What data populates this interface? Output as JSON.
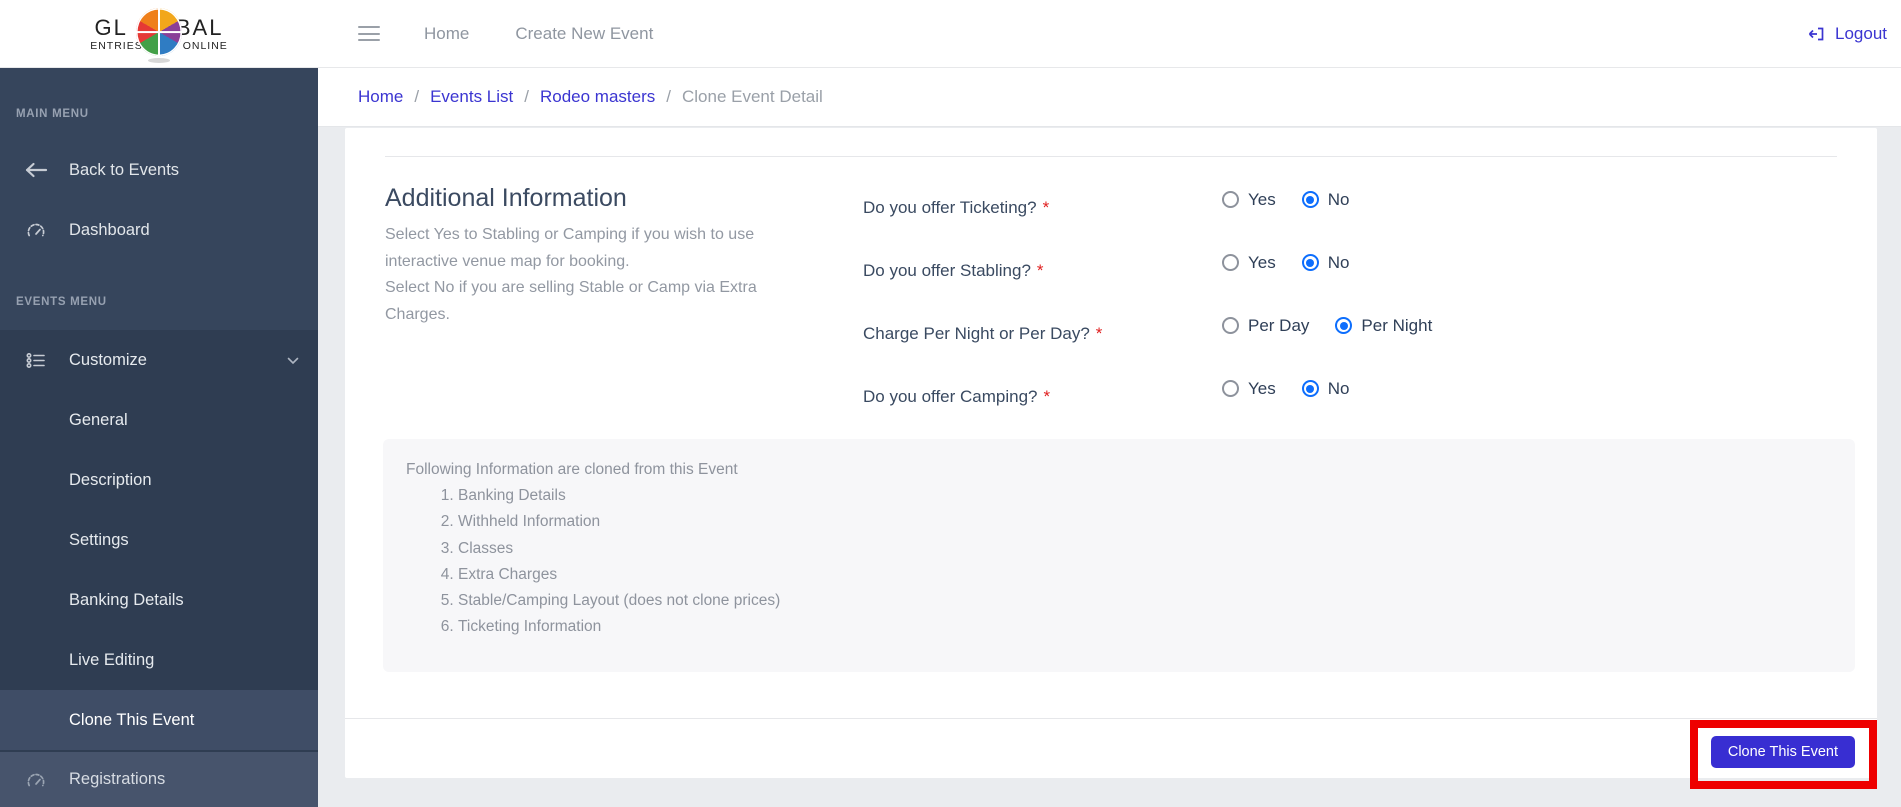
{
  "navbar": {
    "logo": {
      "top_left": "GL",
      "top_right": "BAL",
      "bottom_left": "ENTRIES",
      "bottom_right": "ONLINE"
    },
    "links": [
      "Home",
      "Create New Event"
    ],
    "logout_label": "Logout"
  },
  "breadcrumb": {
    "links": [
      "Home",
      "Events List",
      "Rodeo masters"
    ],
    "current": "Clone Event Detail",
    "separator": "/"
  },
  "sidebar": {
    "main_menu_label": "MAIN MENU",
    "events_menu_label": "EVENTS MENU",
    "main_items": [
      {
        "label": "Back to Events",
        "icon": "arrow-left-icon"
      },
      {
        "label": "Dashboard",
        "icon": "gauge-icon"
      }
    ],
    "customize_label": "Customize",
    "customize_children": [
      "General",
      "Description",
      "Settings",
      "Banking Details",
      "Live Editing",
      "Clone This Event"
    ],
    "active_item": "Clone This Event",
    "registrations_label": "Registrations"
  },
  "main": {
    "section_title": "Additional Information",
    "section_description": [
      "Select Yes to Stabling or Camping if you wish to use interactive venue map for booking.",
      "Select No if you are selling Stable or Camp via Extra Charges."
    ],
    "required_marker": "*",
    "questions": [
      {
        "label": "Do you offer Ticketing?",
        "options": [
          "Yes",
          "No"
        ],
        "selected": "No"
      },
      {
        "label": "Do you offer Stabling?",
        "options": [
          "Yes",
          "No"
        ],
        "selected": "No"
      },
      {
        "label": "Charge Per Night or Per Day?",
        "options": [
          "Per Day",
          "Per Night"
        ],
        "selected": "Per Night"
      },
      {
        "label": "Do you offer Camping?",
        "options": [
          "Yes",
          "No"
        ],
        "selected": "No"
      }
    ],
    "clone_info": {
      "title": "Following Information are cloned from this Event",
      "items": [
        "Banking Details",
        "Withheld Information",
        "Classes",
        "Extra Charges",
        "Stable/Camping Layout (does not clone prices)",
        "Ticketing Information"
      ]
    },
    "clone_button_label": "Clone This Event"
  },
  "colors": {
    "accent_link": "#3b35d1",
    "button_background": "#382ed2",
    "radio_selected": "#0d6efd",
    "annotation_highlight": "#ee0000",
    "sidebar_background": "#36455c",
    "required_marker": "#e02020"
  }
}
